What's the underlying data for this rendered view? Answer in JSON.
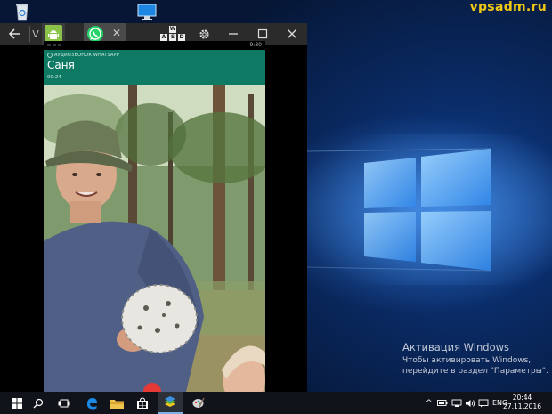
{
  "desktop": {
    "watermark": "vpsadm.ru",
    "icons": [
      "recycle-bin-icon",
      "this-pc-icon"
    ],
    "activation": {
      "title": "Активация Windows",
      "line1": "Чтобы активировать Windows,",
      "line2": "перейдите в раздел \"Параметры\"."
    }
  },
  "emulator": {
    "toolbar": {
      "back_icon": "arrow-left-icon",
      "tab_letter": "V",
      "wasd": [
        "W",
        "A",
        "S",
        "D"
      ],
      "settings_icon": "gear-icon",
      "minimize_icon": "minimize-icon",
      "maximize_icon": "maximize-icon",
      "close_icon": "close-icon",
      "close_tab_glyph": "✕"
    },
    "status_time": "9:30",
    "call": {
      "app_label": "АУДИОЗВОНОК WHATSAPP",
      "contact": "Саня",
      "duration": "00:24"
    }
  },
  "taskbar": {
    "language": "ENG",
    "time": "20:44",
    "date": "27.11.2016",
    "colors": {
      "taskbar": "#101319",
      "whatsapp": "#0f7a63",
      "watermark": "#f0c814"
    }
  }
}
